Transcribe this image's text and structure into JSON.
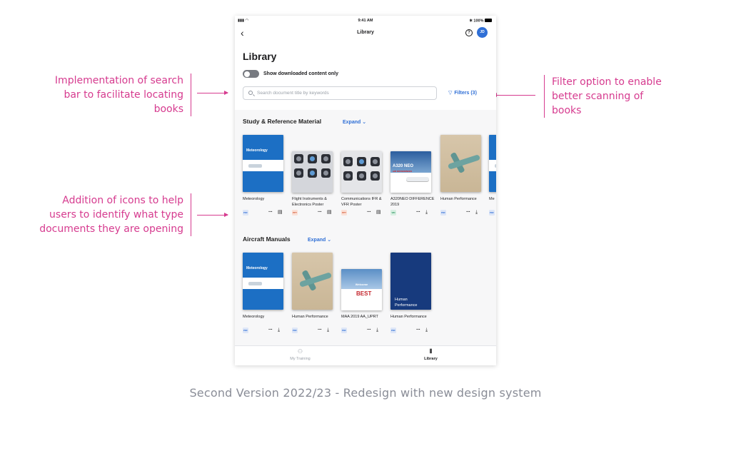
{
  "annotations": {
    "search": "Implementation of search bar to facilitate locating books",
    "icons": "Addition of icons to help users to identify what type documents they are opening",
    "filter": "Filter option to enable better scanning of books"
  },
  "caption": "Second Version 2022/23 - Redesign with new design system",
  "status_bar": {
    "time": "9:41 AM",
    "battery": "100%"
  },
  "nav": {
    "title": "Library",
    "avatar_initials": "JD",
    "help_glyph": "?"
  },
  "header": {
    "title": "Library",
    "toggle_label": "Show downloaded content only",
    "toggle_on": false,
    "search_placeholder": "Search document title by keywords",
    "filters_label": "Filters (3)"
  },
  "sections": [
    {
      "title": "Study & Reference Material",
      "expand_label": "Expand",
      "books": [
        {
          "title": "Meteorology",
          "type": "PDF",
          "action_icon": "save-icon"
        },
        {
          "title": "Flight Instruments & Electronics Poster",
          "type": "PPT",
          "action_icon": "save-icon"
        },
        {
          "title": "Communications IFR & VFR Poster",
          "type": "PPT",
          "action_icon": "save-icon"
        },
        {
          "title": "A320NEO DIFFERENCE 2019",
          "type": "VID",
          "action_icon": "download-icon"
        },
        {
          "title": "Human Performance",
          "type": "PDF",
          "action_icon": "download-icon"
        },
        {
          "title": "Me",
          "type": "PDF",
          "action_icon": "download-icon"
        }
      ]
    },
    {
      "title": "Aircraft Manuals",
      "expand_label": "Expand",
      "books": [
        {
          "title": "Meteorology",
          "type": "PDF",
          "action_icon": "download-icon"
        },
        {
          "title": "Human Performance",
          "type": "PDF",
          "action_icon": "download-icon"
        },
        {
          "title": "MAA 2019 AA_UPRT",
          "type": "PDF",
          "action_icon": "download-icon"
        },
        {
          "title": "Human Performance",
          "type": "PDF",
          "action_icon": "download-icon"
        }
      ]
    }
  ],
  "covers": {
    "meteorology": "Meteorology",
    "a320": "A320 NEO",
    "a320_sub": "AIR DIFFERENCES",
    "maa_welcome": "Welcome",
    "maa_best": "BEST",
    "navy": "Human Performance"
  },
  "tabbar": [
    {
      "label": "My Training",
      "icon": "people-icon",
      "active": false
    },
    {
      "label": "Library",
      "icon": "library-icon",
      "active": true
    }
  ],
  "colors": {
    "accent": "#2f6fd6",
    "annotation": "#d63b8f",
    "caption": "#8a8d97"
  }
}
